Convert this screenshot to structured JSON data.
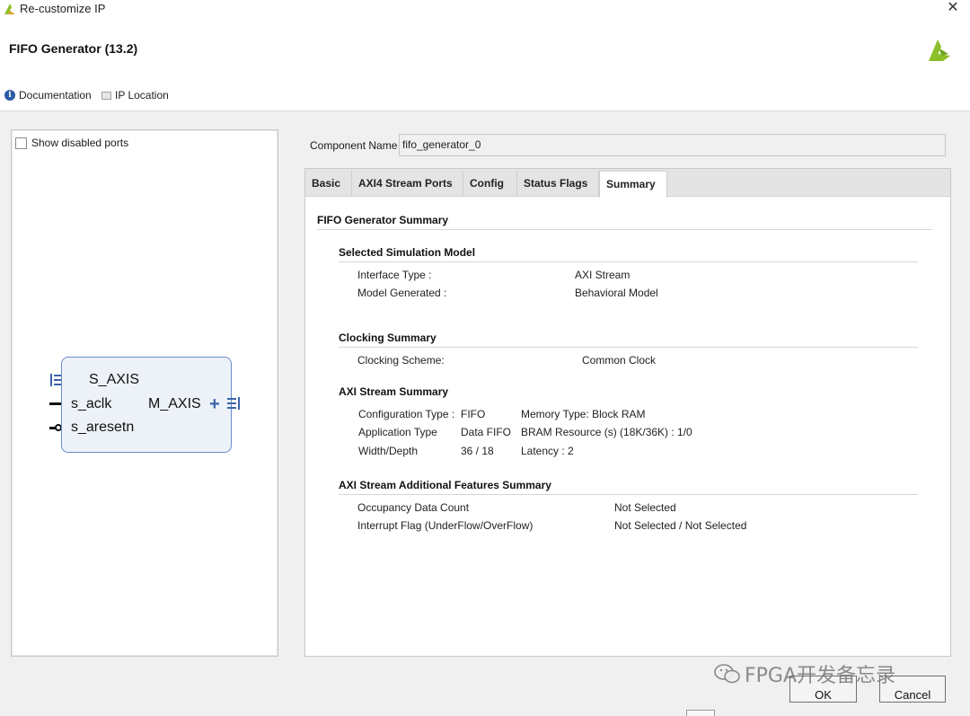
{
  "window": {
    "title": "Re-customize IP",
    "close_glyph": "✕"
  },
  "header": {
    "ip_title": "FIFO Generator (13.2)",
    "documentation_label": "Documentation",
    "ip_location_label": "IP Location"
  },
  "symbol_panel": {
    "show_disabled_ports_label": "Show disabled ports",
    "show_disabled_ports_checked": false,
    "ports": {
      "s_axis": "S_AXIS",
      "s_aclk": "s_aclk",
      "s_aresetn": "s_aresetn",
      "m_axis": "M_AXIS"
    }
  },
  "component": {
    "label": "Component Name",
    "value": "fifo_generator_0"
  },
  "tabs": [
    {
      "label": "Basic",
      "active": false
    },
    {
      "label": "AXI4 Stream Ports",
      "active": false
    },
    {
      "label": "Config",
      "active": false
    },
    {
      "label": "Status Flags",
      "active": false
    },
    {
      "label": "Summary",
      "active": true
    }
  ],
  "summary": {
    "heading": "FIFO Generator Summary",
    "sim_model": {
      "heading": "Selected Simulation Model",
      "rows": [
        {
          "key": "Interface Type :",
          "value": "AXI Stream"
        },
        {
          "key": "Model Generated :",
          "value": "Behavioral Model"
        }
      ]
    },
    "clocking": {
      "heading": "Clocking Summary",
      "rows": [
        {
          "key": "Clocking Scheme:",
          "value": "Common Clock"
        }
      ]
    },
    "axi_stream": {
      "heading": "AXI Stream Summary",
      "rows": [
        {
          "key": "Configuration Type :",
          "value": "FIFO",
          "extra": "Memory Type: Block RAM"
        },
        {
          "key": "Application Type",
          "value": "Data FIFO",
          "extra": "BRAM Resource (s) (18K/36K) : 1/0"
        },
        {
          "key": "Width/Depth",
          "value": "36 / 18",
          "extra": "Latency : 2"
        }
      ]
    },
    "additional": {
      "heading": "AXI Stream Additional Features Summary",
      "rows": [
        {
          "key": "Occupancy Data Count",
          "value": "Not Selected"
        },
        {
          "key": "Interrupt Flag (UnderFlow/OverFlow)",
          "value": "Not Selected / Not Selected"
        }
      ]
    }
  },
  "buttons": {
    "ok": "OK",
    "cancel": "Cancel"
  },
  "watermark": {
    "text": "FPGA开发备忘录"
  },
  "colors": {
    "accent": "#3b63a8",
    "block_fill": "#edf2f8",
    "logo": "#8dbf2a"
  }
}
